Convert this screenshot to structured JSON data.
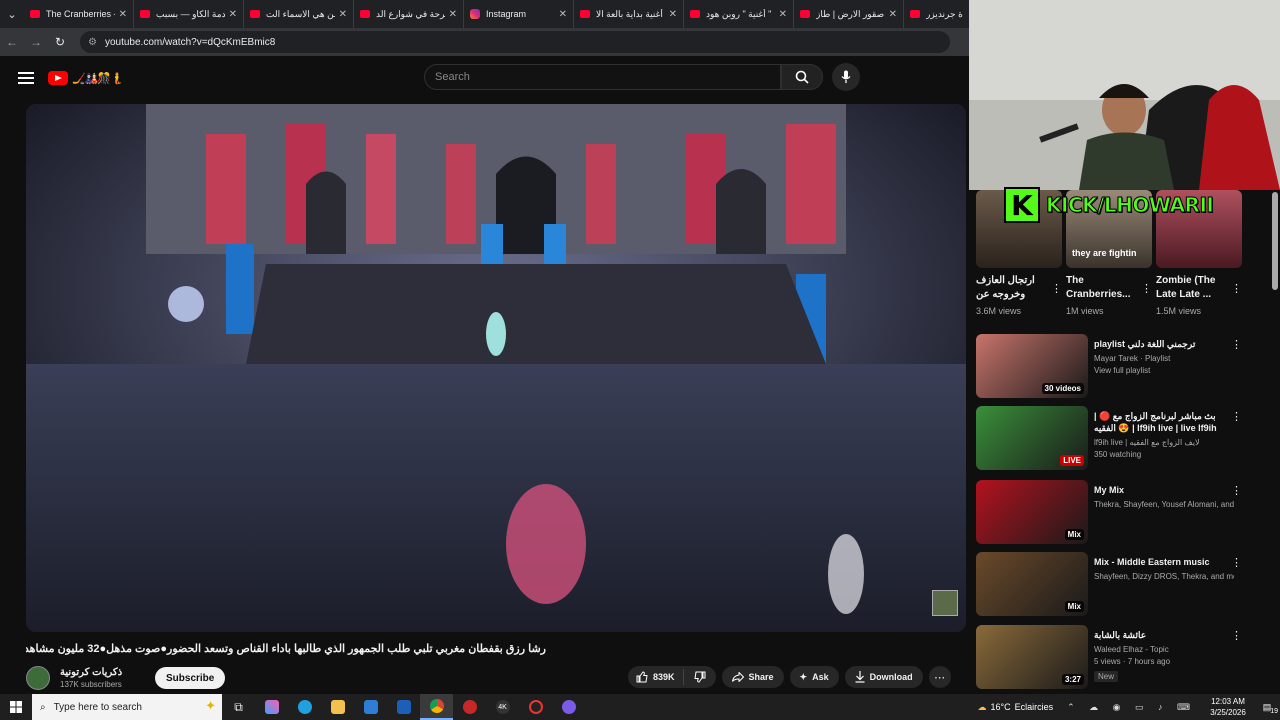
{
  "browser": {
    "tabs": [
      {
        "title": "The Cranberries -",
        "favicon": "youtube"
      },
      {
        "title": "صدمة الكاو — بسبب",
        "favicon": "youtube"
      },
      {
        "title": "من هي الاسماء الت",
        "favicon": "youtube"
      },
      {
        "title": "فرحة في شوارع الد",
        "favicon": "youtube"
      },
      {
        "title": "Instagram",
        "favicon": "instagram"
      },
      {
        "title": "أغنية بداية بالعة الا",
        "favicon": "youtube"
      },
      {
        "title": "أغنية \" روبن هود \"",
        "favicon": "youtube"
      },
      {
        "title": "صقور الارض | طاز",
        "favicon": "youtube"
      },
      {
        "title": "ة جرنديزر",
        "favicon": "youtube"
      }
    ],
    "url": "youtube.com/watch?v=dQcKmEBmic8"
  },
  "youtube": {
    "search_placeholder": "Search",
    "logo_doodle": "🏒🎎🎊🧜"
  },
  "video": {
    "title": "رشا رزق بقفطان مغربي تلبي طلب الجمهور الذي طالبها باداء القناص وتسعد الحضور●صوت مذهل●32 مليون مشاهدة",
    "channel_name": "ذكريات كرتونية",
    "subscribers": "137K subscribers",
    "subscribe_label": "Subscribe",
    "likes": "839K",
    "share_label": "Share",
    "ask_label": "Ask",
    "download_label": "Download"
  },
  "stream_overlay": {
    "kick_logo": "K",
    "kick_text": "KICK/LHOWARII",
    "caption": "they are fightin"
  },
  "shorts": [
    {
      "title": "ارتجال العازف وخروجه عن",
      "views": "3.6M views"
    },
    {
      "title": "The Cranberries...",
      "views": "1M views"
    },
    {
      "title": "Zombie (The Late Late ...",
      "views": "1.5M views"
    }
  ],
  "recommendations": [
    {
      "title": "playlist ترجمني اللغة دلني",
      "channel": "Mayar Tarek · Playlist",
      "extra": "View full playlist",
      "badge": "30 videos",
      "badge_type": "normal",
      "thumb_color": "#c9746b"
    },
    {
      "title": "| 🔴 بث مباشر لبرنامج الزواج مع الفقيه 😍 | lf9ih live | live lf9ih لايف لفقيه",
      "channel": "lf9ih live | لايف الزواج مع الفقيه",
      "extra": "350 watching",
      "badge": "LIVE",
      "badge_type": "live",
      "thumb_color": "#3a8f3a"
    },
    {
      "title": "My Mix",
      "channel": "Thekra, Shayfeen, Yousef Alomani, and ...",
      "extra": "",
      "badge": "Mix",
      "badge_type": "normal",
      "thumb_color": "#b3121f"
    },
    {
      "title": "Mix - Middle Eastern music",
      "channel": "Shayfeen, Dizzy DROS, Thekra, and more",
      "extra": "",
      "badge": "Mix",
      "badge_type": "normal",
      "thumb_color": "#6b4a2a"
    },
    {
      "title": "عائشة بالشابة",
      "channel": "Waleed Elhaz - Topic",
      "extra": "5 views · 7 hours ago",
      "badge": "3:27",
      "badge_type": "normal",
      "new": "New",
      "thumb_color": "#8a6a3a"
    }
  ],
  "taskbar": {
    "search_placeholder": "Type here to search",
    "weather_temp": "16°C",
    "weather_desc": "Eclaircies",
    "time": "12:03 AM",
    "date": "3/25/2026",
    "notification_count": "19"
  },
  "colors": {
    "youtube_red": "#ff0000",
    "kick_green": "#53fc18",
    "background": "#0f0f0f"
  }
}
